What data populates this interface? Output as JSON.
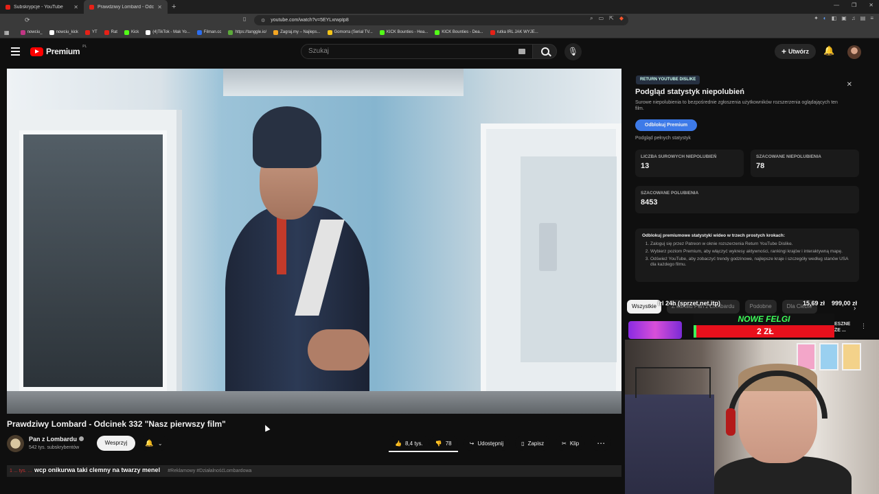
{
  "browser": {
    "tabs": [
      {
        "title": "Subskrypcje - YouTube",
        "active": false
      },
      {
        "title": "Prawdziwy Lombard - Odcinek",
        "active": true
      }
    ],
    "url": "youtube.com/watch?v=5EYLxrwpIp8",
    "bookmarks": [
      {
        "label": "nowciu_",
        "color": "#c13584"
      },
      {
        "label": "nowciu_kick",
        "color": "#ffffff"
      },
      {
        "label": "YT",
        "color": "#e62117"
      },
      {
        "label": "Rat",
        "color": "#e62117"
      },
      {
        "label": "Kick",
        "color": "#53fc18"
      },
      {
        "label": "(4)TikTok - Mak Yo...",
        "color": "#ffffff"
      },
      {
        "label": "Filman.cc",
        "color": "#2b6ef0"
      },
      {
        "label": "https://tanggle.io/",
        "color": "#5caa3a"
      },
      {
        "label": "Zagraj.my – Najleps...",
        "color": "#f5a623"
      },
      {
        "label": "Gomorra (Serial TV...",
        "color": "#f5c518"
      },
      {
        "label": "KICK Bounties - Hea...",
        "color": "#53fc18"
      },
      {
        "label": "KICK Bounties - Dea...",
        "color": "#53fc18"
      },
      {
        "label": "rutka IRL JAK WYJE...",
        "color": "#e62117"
      }
    ]
  },
  "youtube": {
    "logo_text": "Premium",
    "logo_region": "PL",
    "search_placeholder": "Szukaj",
    "create_label": "Utwórz"
  },
  "video": {
    "title": "Prawdziwy Lombard - Odcinek 332 \"Nasz pierwszy film\"",
    "channel": "Pan z Lombardu",
    "subscribers": "542 tys. subskrybentów",
    "support_label": "Wesprzyj",
    "likes": "8,4 tys.",
    "dislikes": "78",
    "share_label": "Udostępnij",
    "save_label": "Zapisz",
    "clip_label": "Klip",
    "description_tags": "#Reklamowy #DziałalnośćLombardowa",
    "description_prefix": "1 ... tys. ...",
    "caption": "wcp onikurwa taki clemny na twarzy menel"
  },
  "ryd": {
    "tag": "RETURN YOUTUBE DISLIKE",
    "title": "Podgląd statystyk niepolubień",
    "description": "Surowe niepolubienia to bezpośrednie zgłoszenia użytkowników rozszerzenia oglądających ten film.",
    "unlock_label": "Odblokuj Premium",
    "full_stats": "Podgląd pełnych statystyk",
    "stats": [
      {
        "label": "LICZBA SUROWYCH NIEPOLUBIEŃ",
        "value": "13"
      },
      {
        "label": "SZACOWANE NIEPOLUBIENIA",
        "value": "78"
      },
      {
        "label": "SZACOWANE POLUBIENIA",
        "value": "8453"
      }
    ],
    "steps_heading": "Odblokuj premiumowe statystyki wideo w trzech prostych krokach:",
    "steps": [
      "Zaloguj się przez Patreon w oknie rozszerzenia Return YouTube Dislike.",
      "Wybierz poziom Premium, aby włączyć wykresy aktywności, rankingi krajów i interaktywną mapę.",
      "Odśwież YouTube, aby zobaczyć trendy godzinowe, najlepsze kraje i szczegóły według stanów USA dla każdego filmu."
    ]
  },
  "sidebar": {
    "chips": [
      "Wszystkie",
      "Z kanału Pan z Lombardu",
      "Podobne",
      "Dla Ciebie"
    ],
    "overlay_left": "irl 24h (sprzet,net,itp)",
    "overlay_mid": "15,69 zł",
    "overlay_right": "999,00 zł",
    "felgi_title": "NOWE FELGI",
    "felgi_amount": "2 ZŁ",
    "side_text_1": "ESZNE",
    "side_text_2": "ŻE ..."
  }
}
